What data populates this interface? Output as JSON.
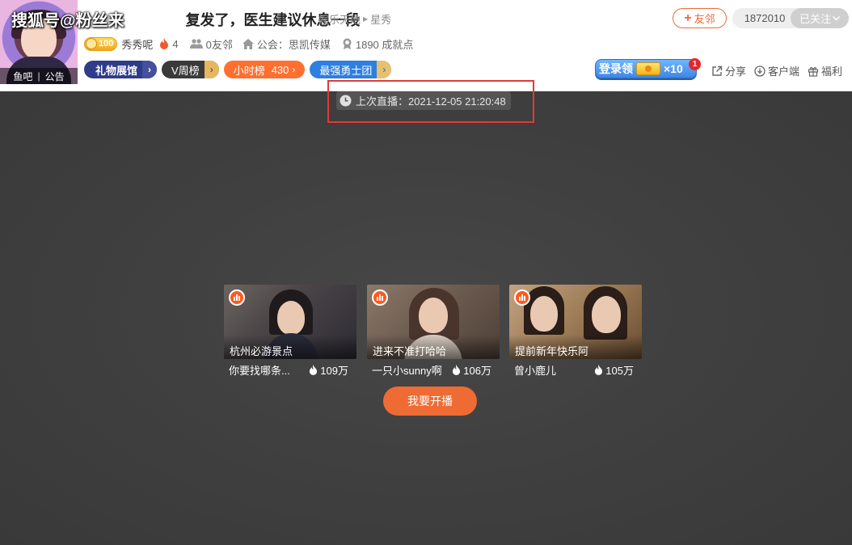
{
  "watermark": "搜狐号@粉丝来",
  "room": {
    "title": "复发了，医生建议休息一段",
    "category_parent": "娱乐天地",
    "category_child": "星秀"
  },
  "avatar": {
    "bar_left": "鱼吧",
    "bar_sep": "|",
    "bar_right": "公告"
  },
  "meta": {
    "level": "100",
    "nickname": "秀秀呢",
    "heat": "4",
    "friends": "0友邻",
    "guild": "公会：思凯传媒",
    "achievements": "1890 成就点"
  },
  "tags": {
    "gift_hall": "礼物展馆",
    "v_week": "V周榜",
    "hour_rank_label": "小时榜",
    "hour_rank_value": "430",
    "brave": "最强勇士团"
  },
  "actions": {
    "friend_btn": "友邻",
    "follower_count": "1872010",
    "followed": "已关注",
    "login_reward": "登录领",
    "login_multiplier": "×10",
    "notif_count": "1",
    "share": "分享",
    "client": "客户端",
    "welfare": "福利"
  },
  "player": {
    "last_live": "上次直播：2021-12-05 21:20:48",
    "go_live_btn": "我要开播",
    "recommendations": [
      {
        "thumb_title": "杭州必游景点",
        "name": "你要找哪条...",
        "heat": "109万"
      },
      {
        "thumb_title": "进来不准打哈哈",
        "name": "一只小sunny啊",
        "heat": "106万"
      },
      {
        "thumb_title": "提前新年快乐阿",
        "name": "曾小鹿儿",
        "heat": "105万"
      }
    ]
  },
  "colors": {
    "accent": "#ef6b34",
    "player_bg": "#3b3b3b",
    "highlight": "#e53935"
  }
}
